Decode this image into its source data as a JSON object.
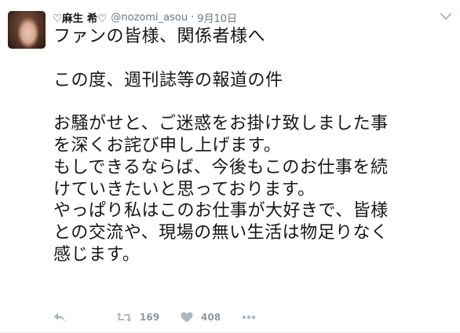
{
  "tweet": {
    "fullname": "♡麻生 希♡",
    "username": "@nozomi_asou",
    "separator": "·",
    "timestamp": "9月10日",
    "lines": [
      "ファンの皆様、関係者様へ",
      "",
      "この度、週刊誌等の報道の件",
      "",
      "お騒がせと、ご迷惑をお掛け致しました事",
      "を深くお詫び申し上げます。",
      "もしできるならば、今後もこのお仕事を続",
      "けていきたいと思っております。",
      "やっぱり私はこのお仕事が大好きで、皆様",
      "との交流や、現場の無い生活は物足りなく",
      "感じます。"
    ]
  },
  "actions": {
    "retweet_count": "169",
    "like_count": "408"
  },
  "icons": {
    "reply": "reply-icon",
    "retweet": "retweet-icon",
    "like": "heart-icon",
    "more": "more-icon",
    "caret": "chevron-down-icon"
  },
  "colors": {
    "text": "#14171a",
    "muted": "#657786",
    "icon": "#aab8c2"
  }
}
